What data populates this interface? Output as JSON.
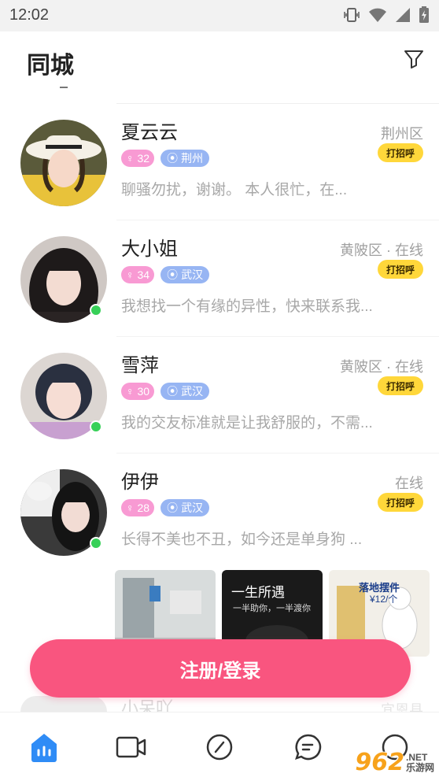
{
  "status_bar": {
    "time": "12:02"
  },
  "header": {
    "title": "同城"
  },
  "users": [
    {
      "name": "夏云云",
      "location": "荆州区",
      "age": "32",
      "city": "荆州",
      "greet": "打招呼",
      "bio": "聊骚勿扰，谢谢。 本人很忙，在...",
      "online": false
    },
    {
      "name": "大小姐",
      "location": "黄陂区 · 在线",
      "age": "34",
      "city": "武汉",
      "greet": "打招呼",
      "bio": "我想找一个有缘的异性，快来联系我...",
      "online": true
    },
    {
      "name": "雪萍",
      "location": "黄陂区 · 在线",
      "age": "30",
      "city": "武汉",
      "greet": "打招呼",
      "bio": "我的交友标准就是让我舒服的，不需...",
      "online": true
    },
    {
      "name": "伊伊",
      "location": "在线",
      "age": "28",
      "city": "武汉",
      "greet": "打招呼",
      "bio": "长得不美也不丑，如今还是单身狗 ...",
      "online": true
    }
  ],
  "photos": [
    {
      "caption": ""
    },
    {
      "caption": "一生所遇",
      "sub": "一半助你，一半渡你"
    },
    {
      "caption": "落地摆件",
      "sub": "¥12/个"
    }
  ],
  "next_user": {
    "name": "小呆吖",
    "location": "宜恩县"
  },
  "register_button": "注册/登录",
  "nav": {
    "items": [
      "home-icon",
      "video-icon",
      "discover-icon",
      "message-icon",
      "profile-icon"
    ],
    "accent": "#2f8cf6"
  },
  "watermark": {
    "number": "962",
    "suffix": ".NET",
    "label": "乐游网"
  },
  "colors": {
    "accent": "#f9557f",
    "greet": "#ffd73a",
    "age_tag": "#f89ad3",
    "city_tag": "#97b5f3",
    "online": "#37d058"
  }
}
